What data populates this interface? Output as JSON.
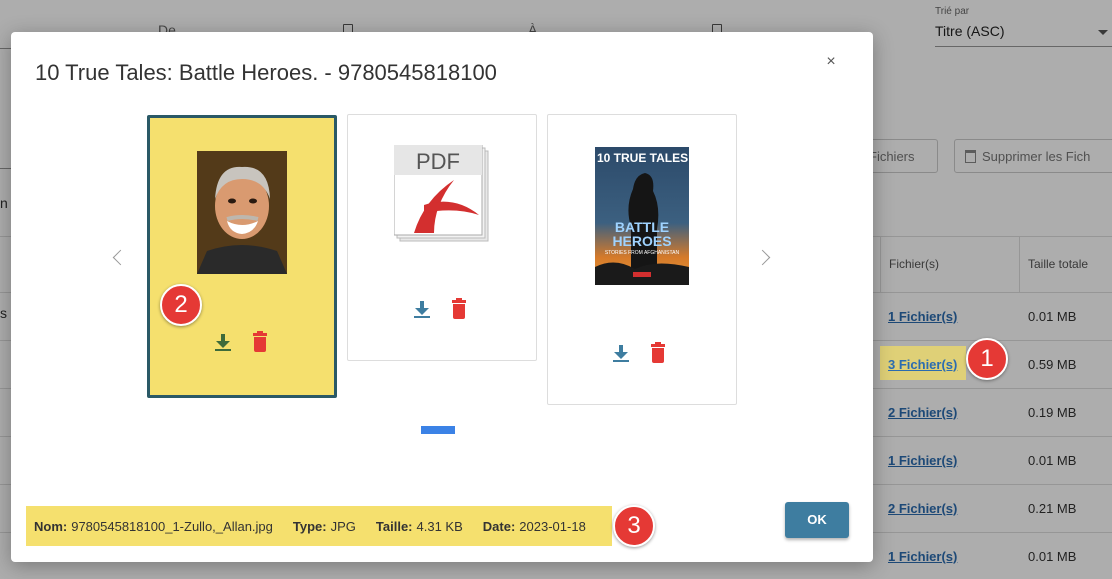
{
  "background": {
    "date_from_label": "De",
    "date_to_label": "À",
    "sort": {
      "label": "Trié par",
      "value": "Titre (ASC)"
    },
    "buttons": {
      "files": "Fichiers",
      "delete_files": "Supprimer les Fich"
    },
    "side_texts": [
      "n t",
      "s le"
    ],
    "table": {
      "headers": {
        "files": "Fichier(s)",
        "total_size": "Taille totale"
      },
      "rows": [
        {
          "files": "1 Fichier(s)",
          "size": "0.01 MB"
        },
        {
          "files": "3 Fichier(s)",
          "size": "0.59 MB"
        },
        {
          "files": "2 Fichier(s)",
          "size": "0.19 MB"
        },
        {
          "files": "1 Fichier(s)",
          "size": "0.01 MB"
        },
        {
          "files": "2 Fichier(s)",
          "size": "0.21 MB"
        },
        {
          "files": "1 Fichier(s)",
          "size": "0.01 MB"
        }
      ]
    }
  },
  "modal": {
    "title": "10 True Tales: Battle Heroes. - 9780545818100",
    "close_glyph": "×",
    "pdf_label": "PDF",
    "cover": {
      "title_line1": "10 TRUE TALES",
      "title_line2": "BATTLE",
      "title_line3": "HEROES",
      "subtitle": "STORIES FROM AFGHANISTAN"
    },
    "info": {
      "name_label": "Nom:",
      "name_value": "9780545818100_1-Zullo,_Allan.jpg",
      "type_label": "Type:",
      "type_value": "JPG",
      "size_label": "Taille:",
      "size_value": "4.31 KB",
      "date_label": "Date:",
      "date_value": "2023-01-18"
    },
    "ok_label": "OK"
  },
  "badges": {
    "one": "1",
    "two": "2",
    "three": "3"
  },
  "colors": {
    "accent": "#3e7da0",
    "highlight": "#f5e06e",
    "selected_border": "#2a5966",
    "delete": "#e53935",
    "pager": "#3b82e6",
    "link": "#2b6cb0",
    "badge": "#e53935"
  }
}
